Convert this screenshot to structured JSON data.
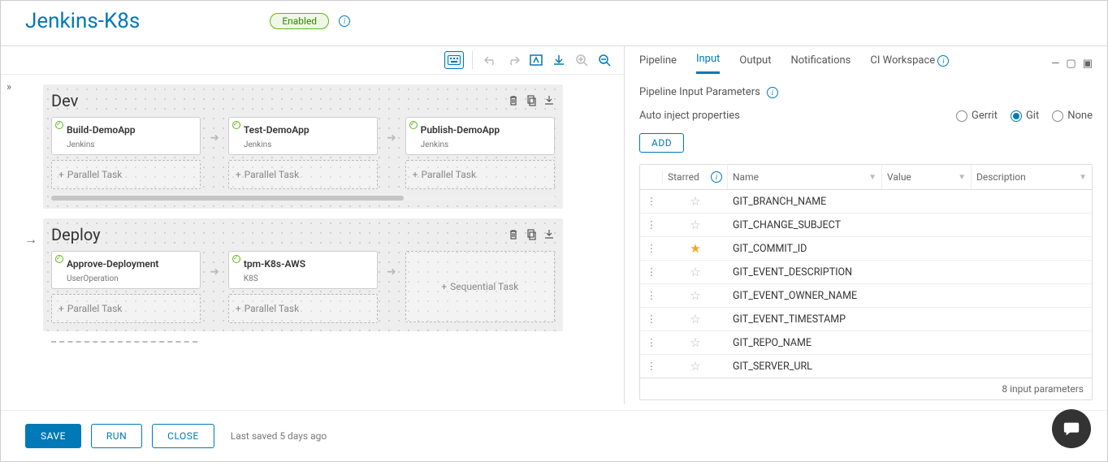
{
  "header": {
    "title": "Jenkins-K8s",
    "status": "Enabled"
  },
  "toolbar": {
    "keyboard": "keyboard",
    "undo": "undo",
    "redo": "redo",
    "fit": "fit-screen",
    "download": "download",
    "zoom_in": "zoom-in",
    "zoom_out": "zoom-out"
  },
  "stages": [
    {
      "name": "Dev",
      "has_arrow_in": false,
      "tasks": [
        {
          "name": "Build-DemoApp",
          "type": "Jenkins"
        },
        {
          "name": "Test-DemoApp",
          "type": "Jenkins"
        },
        {
          "name": "Publish-DemoApp",
          "type": "Jenkins"
        }
      ],
      "parallel_label": "Parallel Task",
      "scrollbar": true
    },
    {
      "name": "Deploy",
      "has_arrow_in": true,
      "tasks": [
        {
          "name": "Approve-Deployment",
          "type": "UserOperation"
        },
        {
          "name": "tpm-K8s-AWS",
          "type": "K8S"
        }
      ],
      "parallel_label": "Parallel Task",
      "sequential_label": "Sequential Task"
    }
  ],
  "right": {
    "tabs": [
      "Pipeline",
      "Input",
      "Output",
      "Notifications",
      "CI Workspace"
    ],
    "active_tab": "Input",
    "section_title": "Pipeline Input Parameters",
    "auto_inject_label": "Auto inject properties",
    "radios": [
      "Gerrit",
      "Git",
      "None"
    ],
    "radio_selected": "Git",
    "add_label": "ADD",
    "columns": {
      "starred": "Starred",
      "name": "Name",
      "value": "Value",
      "desc": "Description"
    },
    "rows": [
      {
        "starred": false,
        "name": "GIT_BRANCH_NAME",
        "value": "",
        "desc": ""
      },
      {
        "starred": false,
        "name": "GIT_CHANGE_SUBJECT",
        "value": "",
        "desc": ""
      },
      {
        "starred": true,
        "name": "GIT_COMMIT_ID",
        "value": "",
        "desc": ""
      },
      {
        "starred": false,
        "name": "GIT_EVENT_DESCRIPTION",
        "value": "",
        "desc": ""
      },
      {
        "starred": false,
        "name": "GIT_EVENT_OWNER_NAME",
        "value": "",
        "desc": ""
      },
      {
        "starred": false,
        "name": "GIT_EVENT_TIMESTAMP",
        "value": "",
        "desc": ""
      },
      {
        "starred": false,
        "name": "GIT_REPO_NAME",
        "value": "",
        "desc": ""
      },
      {
        "starred": false,
        "name": "GIT_SERVER_URL",
        "value": "",
        "desc": ""
      }
    ],
    "footer_text": "8 input parameters"
  },
  "footer": {
    "save": "SAVE",
    "run": "RUN",
    "close": "CLOSE",
    "last_saved": "Last saved 5 days ago"
  }
}
